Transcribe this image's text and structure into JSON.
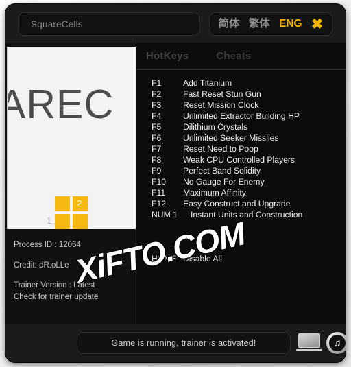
{
  "window": {
    "title_field_value": "SquareCells",
    "languages": [
      {
        "label": "简体",
        "active": false
      },
      {
        "label": "繁体",
        "active": false
      },
      {
        "label": "ENG",
        "active": true
      }
    ],
    "close_icon": "✖",
    "accent_color": "#f2b500"
  },
  "left_panel": {
    "thumbnail": {
      "word": "AREC",
      "cell_label_top": "2",
      "cell_label_bottom": "1",
      "cell_color": "#f5b912",
      "background_color": "#f3f3f3"
    },
    "process_id_label": "Process ID : 12064",
    "credit_label": "Credit:   dR.oLLe",
    "trainer_version_label": "Trainer Version : Latest",
    "update_link_label": "Check for trainer update"
  },
  "right_panel": {
    "tabs": [
      {
        "label": "HotKeys",
        "active": true
      },
      {
        "label": "Cheats",
        "active": false
      }
    ],
    "hotkeys": [
      {
        "key": "F1",
        "label": "Add Titanium"
      },
      {
        "key": "F2",
        "label": "Fast Reset Stun Gun"
      },
      {
        "key": "F3",
        "label": "Reset Mission Clock"
      },
      {
        "key": "F4",
        "label": "Unlimited Extractor Building HP"
      },
      {
        "key": "F5",
        "label": "Dilithium Crystals"
      },
      {
        "key": "F6",
        "label": "Unlimited Seeker Missiles"
      },
      {
        "key": "F7",
        "label": "Reset Need to Poop"
      },
      {
        "key": "F8",
        "label": "Weak CPU Controlled Players"
      },
      {
        "key": "F9",
        "label": "Perfect Band Solidity"
      },
      {
        "key": "F10",
        "label": "No Gauge For Enemy"
      },
      {
        "key": "F11",
        "label": "Maximum Affinity"
      },
      {
        "key": "F12",
        "label": "Easy Construct and Upgrade"
      },
      {
        "key": "NUM 1",
        "label": "Instant Units and Construction"
      }
    ],
    "disable_all": {
      "key": "HOME",
      "label": "Disable All"
    }
  },
  "bottom_bar": {
    "status_text": "Game is running, trainer is activated!",
    "laptop_icon_name": "laptop-icon",
    "music_icon_glyph": "♫"
  },
  "watermark": {
    "text": "XiFTO.COM"
  }
}
